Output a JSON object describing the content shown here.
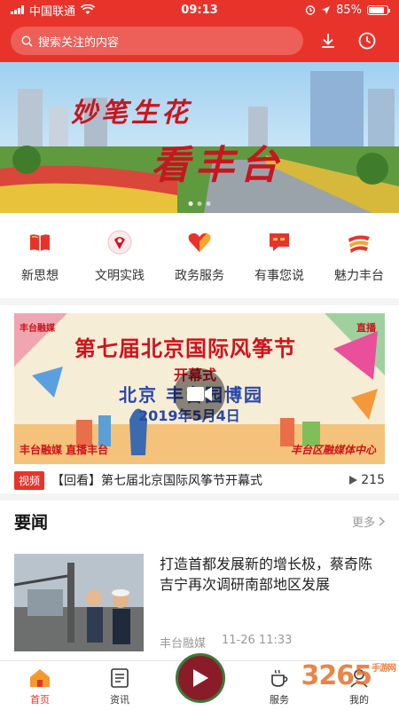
{
  "status": {
    "carrier": "中国联通",
    "time": "09:13",
    "battery": "85%"
  },
  "search": {
    "placeholder": "搜索关注的内容"
  },
  "banner": {
    "line1": "妙笔生花",
    "line2": "看丰台"
  },
  "quick_links": [
    {
      "label": "新思想",
      "icon": "book-icon"
    },
    {
      "label": "文明实践",
      "icon": "civilization-badge-icon"
    },
    {
      "label": "政务服务",
      "icon": "heart-service-icon"
    },
    {
      "label": "有事您说",
      "icon": "chat-bubble-icon"
    },
    {
      "label": "魅力丰台",
      "icon": "fengtai-flag-icon"
    }
  ],
  "video": {
    "brand": "丰台融媒",
    "live_badge": "直播",
    "title_main": "第七届北京国际风筝节",
    "title_sub": "开幕式",
    "venue": "北京 丰台园博园",
    "date": "2019年5月4日",
    "footer_left": "丰台融媒 直播丰台",
    "footer_right": "丰台区融媒体中心",
    "tag": "视频",
    "caption": "【回看】第七届北京国际风筝节开幕式",
    "views": "215"
  },
  "section": {
    "title": "要闻",
    "more": "更多"
  },
  "news": [
    {
      "title": "打造首都发展新的增长极，蔡奇陈吉宁再次调研南部地区发展",
      "source": "丰台融媒",
      "time": "11-26 11:33"
    }
  ],
  "tabs": [
    {
      "label": "首页",
      "icon": "home-icon",
      "active": true
    },
    {
      "label": "资讯",
      "icon": "news-doc-icon",
      "active": false
    },
    {
      "label": "服务",
      "icon": "service-cup-icon",
      "active": false
    },
    {
      "label": "我的",
      "icon": "user-icon",
      "active": false
    }
  ],
  "watermark": {
    "text": "3265",
    "sub": "手游网"
  },
  "colors": {
    "brand_red": "#e8332b"
  }
}
